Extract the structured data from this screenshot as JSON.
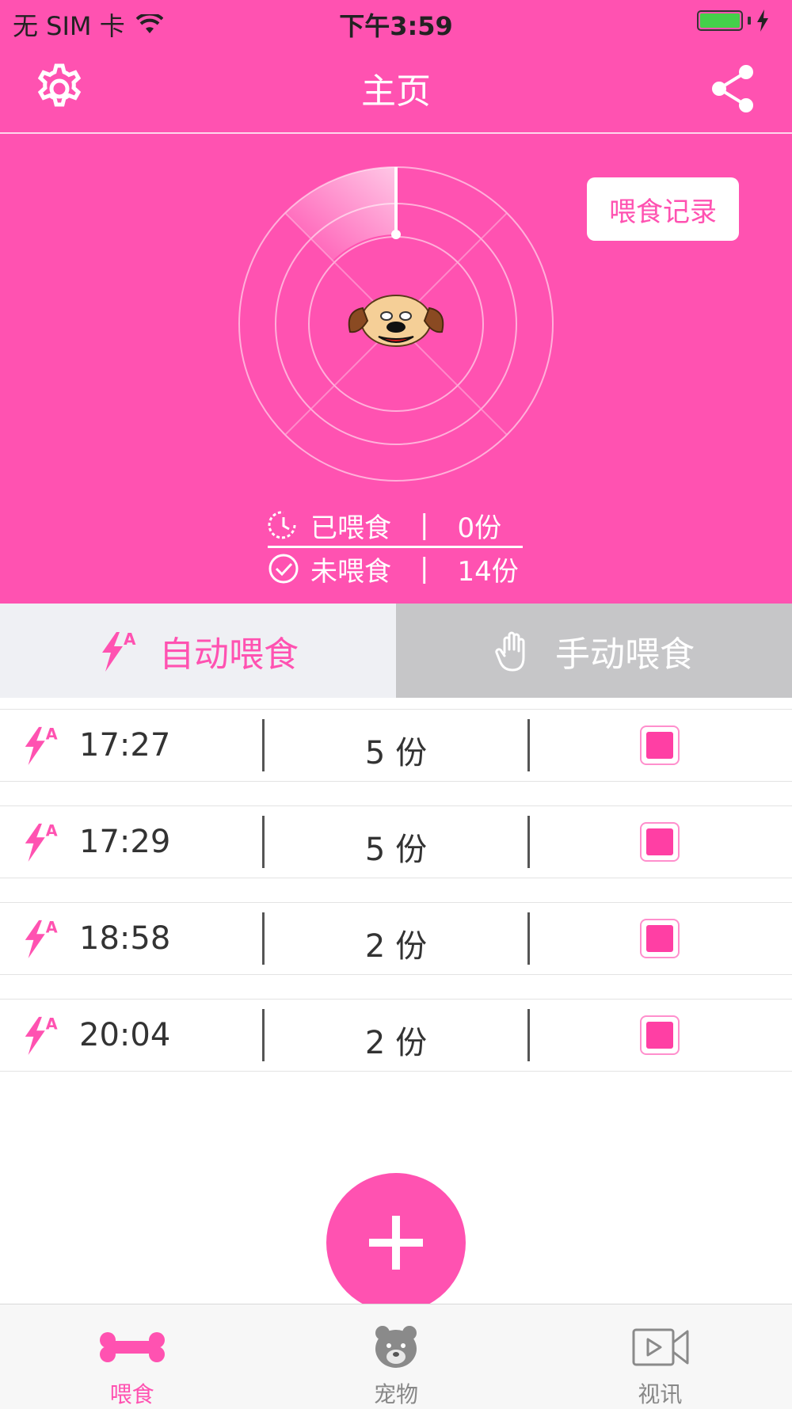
{
  "status_bar": {
    "carrier": "无 SIM 卡",
    "time": "下午3:59",
    "battery_color": "#44d04a"
  },
  "navbar": {
    "title": "主页",
    "left_icon": "gear-icon",
    "right_icon": "share-icon"
  },
  "hero": {
    "record_button": "喂食记录",
    "fed_label": "已喂食",
    "fed_value": "0份",
    "unfed_label": "未喂食",
    "unfed_value": "14份",
    "separator": "|",
    "accent_color": "#ff52b1"
  },
  "tabs": {
    "auto_label": "自动喂食",
    "manual_label": "手动喂食"
  },
  "schedule": [
    {
      "time": "17:27",
      "qty": "5 份",
      "enabled": true
    },
    {
      "time": "17:29",
      "qty": "5 份",
      "enabled": true
    },
    {
      "time": "18:58",
      "qty": "2 份",
      "enabled": true
    },
    {
      "time": "20:04",
      "qty": "2 份",
      "enabled": true
    }
  ],
  "tabbar": {
    "feed_label": "喂食",
    "pet_label": "宠物",
    "video_label": "视讯"
  }
}
